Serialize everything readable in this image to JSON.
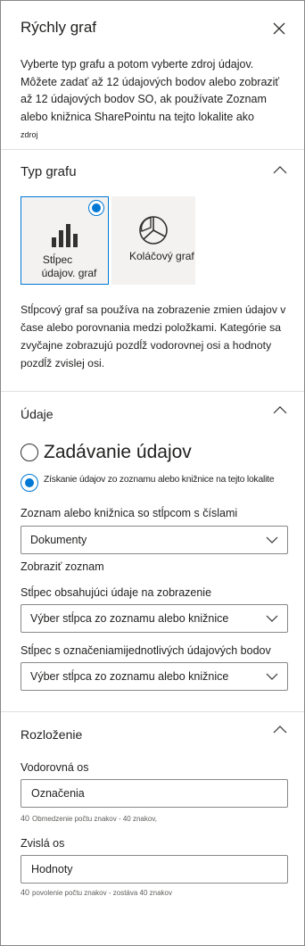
{
  "panel": {
    "title": "Rýchly graf",
    "intro_text": "Vyberte typ grafu a potom vyberte zdroj údajov. Môžete zadať až 12 údajových bodov alebo zobraziť až 12 údajových bodov SO, ak používate Zoznam alebo knižnica SharePointu na tejto lokalite ako",
    "intro_small": "zdroj"
  },
  "chart_type": {
    "section_title": "Typ grafu",
    "tiles": [
      {
        "label_line1": "Stĺpec",
        "label_line2": "údajov. graf",
        "icon": "bar-chart-icon",
        "selected": true
      },
      {
        "label_line1": "Koláčový graf",
        "label_line2": "",
        "icon": "pie-chart-icon",
        "selected": false
      }
    ],
    "description": "Stĺpcový graf sa používa na zobrazenie zmien údajov v čase alebo porovnania medzi položkami. Kategórie sa zvyčajne zobrazujú pozdĺž vodorovnej osi a hodnoty pozdĺž zvislej osi."
  },
  "data": {
    "section_title": "Údaje",
    "radio_enter": "Zadávanie údajov",
    "radio_list": "Získanie údajov zo zoznamu alebo knižnice na tejto lokalite",
    "list_label": "Zoznam alebo knižnica so stĺpcom s číslami",
    "list_value": "Dokumenty",
    "view_label": "Zobraziť zoznam",
    "column_label": "Stĺpec obsahujúci údaje na zobrazenie",
    "column_value": "Výber stĺpca zo zoznamu alebo knižnice",
    "labels_column_label": "Stĺpec s označeniamijednotlivých údajových bodov",
    "labels_column_value": "Výber stĺpca zo zoznamu alebo knižnice"
  },
  "layout": {
    "section_title": "Rozloženie",
    "horizontal_label": "Vodorovná os",
    "horizontal_value": "Označenia",
    "horizontal_hint_num": "40",
    "horizontal_hint": "Obmedzenie počtu znakov - 40 znakov,",
    "vertical_label": "Zvislá os",
    "vertical_value": "Hodnoty",
    "vertical_hint_num": "40",
    "vertical_hint": "povolenie počtu znakov - zostáva 40 znakov"
  },
  "colors": {
    "accent": "#0078d4",
    "text": "#201f1e",
    "border": "#8a8886",
    "tile_bg": "#f3f2f1"
  }
}
